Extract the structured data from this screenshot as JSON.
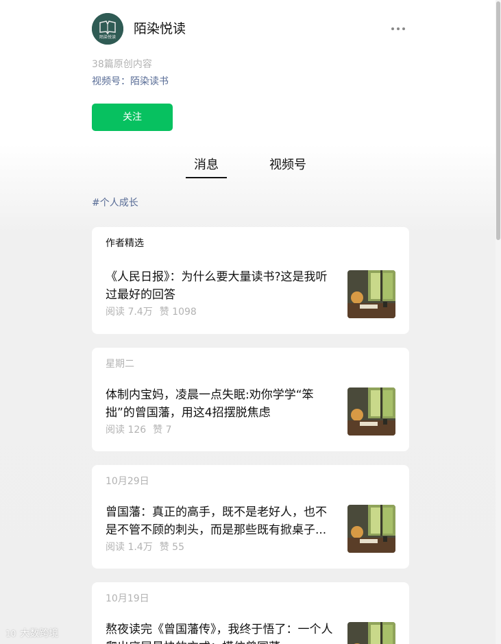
{
  "account": {
    "name": "陌染悦读",
    "avatar_text": "陌染悦读",
    "original_count": "38篇原创内容",
    "channel_prefix": "视频号：",
    "channel_name": "陌染读书",
    "follow_label": "关注"
  },
  "tabs": [
    {
      "label": "消息",
      "active": true
    },
    {
      "label": "视频号",
      "active": false
    }
  ],
  "hashtag": "#个人成长",
  "articles": [
    {
      "label": "作者精选",
      "title": "《人民日报》：为什么要大量读书?这是我听过最好的回答",
      "reads": "阅读 7.4万",
      "likes": "赞 1098"
    },
    {
      "label": "星期二",
      "title": "体制内宝妈，凌晨一点失眠:劝你学学“笨拙”的曾国藩，用这4招摆脱焦虑",
      "reads": "阅读 126",
      "likes": "赞 7"
    },
    {
      "label": "10月29日",
      "title": "曾国藩：真正的高手，既不是老好人，也不是不管不顾的刺头，而是那些既有掀桌子...",
      "reads": "阅读 1.4万",
      "likes": "赞 55"
    },
    {
      "label": "10月19日",
      "title": "熬夜读完《曾国藩传》，我终于悟了：一个人爬出底层最快的方式：模仿曾国藩",
      "reads": "",
      "likes": ""
    }
  ],
  "watermark": {
    "logo": "10",
    "text": "大数跨境"
  },
  "colors": {
    "accent_green": "#07c160",
    "link_blue": "#576b95",
    "muted_gray": "#b2b2b2"
  },
  "icons": {
    "more": "more-dots-icon",
    "avatar": "book-logo-icon"
  }
}
